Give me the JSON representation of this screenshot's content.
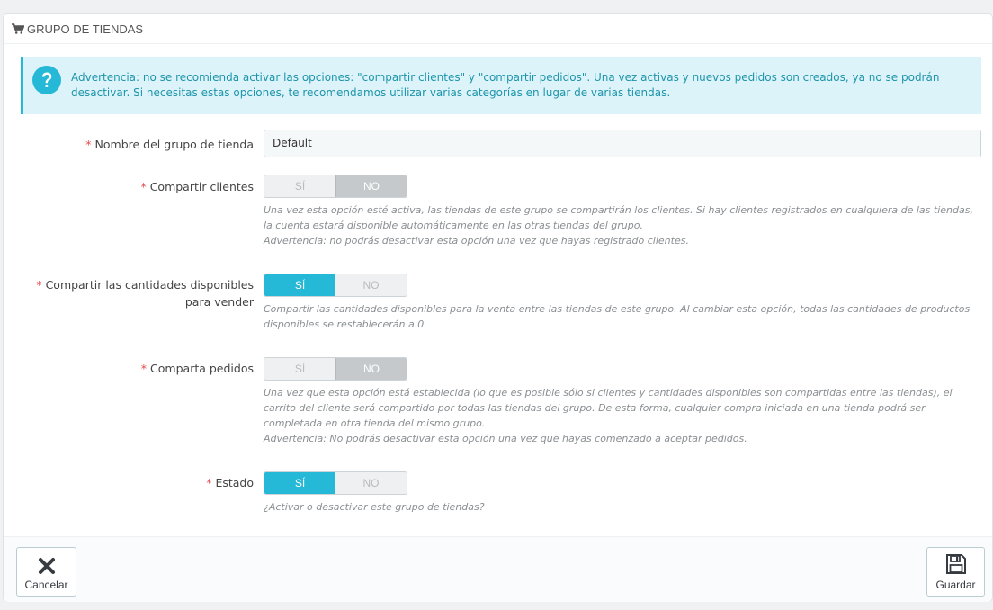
{
  "panel": {
    "title": "GRUPO DE TIENDAS",
    "icon": "cart-icon"
  },
  "alert": {
    "icon": "question-icon",
    "text": "Advertencia: no se recomienda activar las opciones: \"compartir clientes\" y \"compartir pedidos\". Una vez activas y nuevos pedidos son creados, ya no se podrán desactivar. Si necesitas estas opciones, te recomendamos utilizar varias categorías en lugar de varias tiendas."
  },
  "form": {
    "required_mark": "*",
    "name_field": {
      "label": "Nombre del grupo de tienda",
      "value": "Default"
    },
    "share_customers": {
      "label": "Compartir clientes",
      "yes": "SÍ",
      "no": "NO",
      "selected": "no",
      "help": [
        "Una vez esta opción esté activa, las tiendas de este grupo se compartirán los clientes. Si hay clientes registrados en cualquiera de las tiendas, la cuenta estará disponible automáticamente en las otras tiendas del grupo.",
        "Advertencia: no podrás desactivar esta opción una vez que hayas registrado clientes."
      ]
    },
    "share_stock": {
      "label": "Compartir las cantidades disponibles para vender",
      "yes": "SÍ",
      "no": "NO",
      "selected": "yes",
      "help": [
        "Compartir las cantidades disponibles para la venta entre las tiendas de este grupo. Al cambiar esta opción, todas las cantidades de productos disponibles se restablecerán a 0."
      ]
    },
    "share_orders": {
      "label": "Comparta pedidos",
      "yes": "SÍ",
      "no": "NO",
      "selected": "no",
      "help": [
        "Una vez que esta opción está establecida (lo que es posible sólo si clientes y cantidades disponibles son compartidas entre las tiendas), el carrito del cliente será compartido por todas las tiendas del grupo. De esta forma, cualquier compra iniciada en una tienda podrá ser completada en otra tienda del mismo grupo.",
        "Advertencia: No podrás desactivar esta opción una vez que hayas comenzado a aceptar pedidos."
      ]
    },
    "status": {
      "label": "Estado",
      "yes": "SÍ",
      "no": "NO",
      "selected": "yes",
      "help": [
        "¿Activar o desactivar este grupo de tiendas?"
      ]
    }
  },
  "footer": {
    "cancel_label": "Cancelar",
    "save_label": "Guardar"
  },
  "colors": {
    "accent": "#25b9d7",
    "required": "#e64b4b",
    "alert_bg": "#dcf4f9",
    "alert_text": "#1e94ab"
  }
}
